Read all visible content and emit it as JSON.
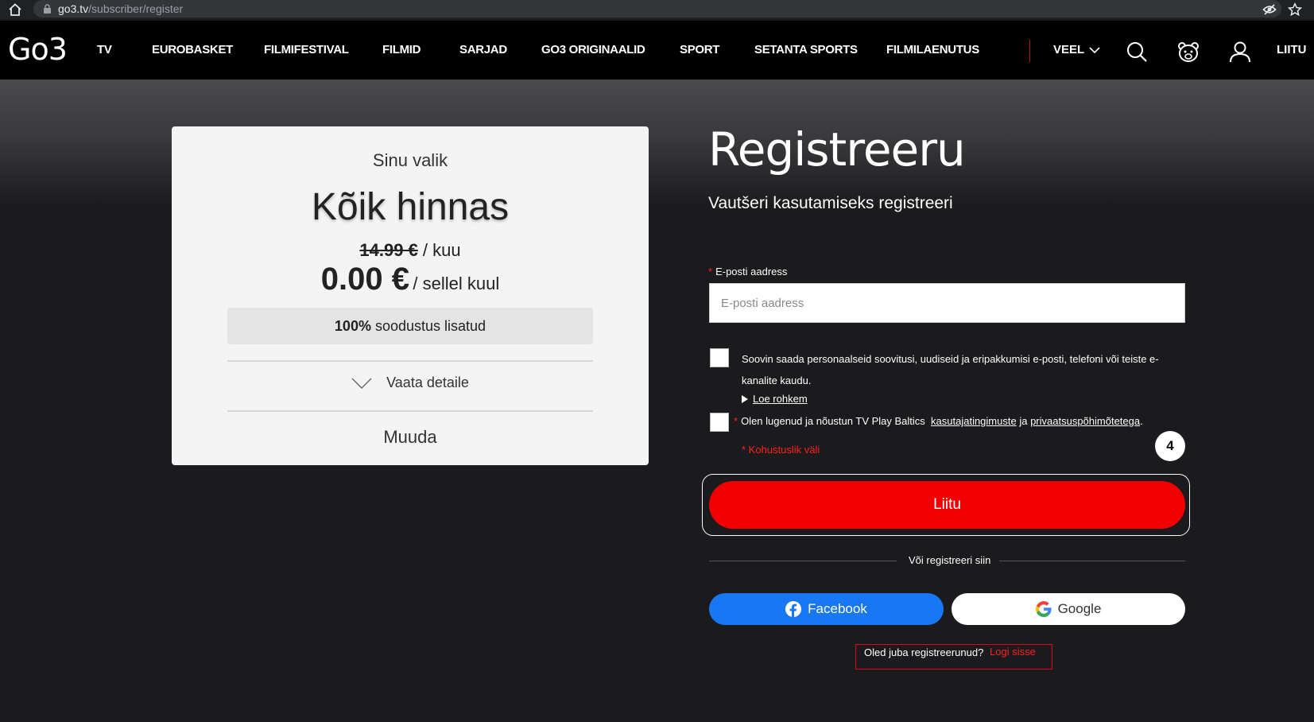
{
  "browser": {
    "url_host": "go3.tv",
    "url_path": "/subscriber/register"
  },
  "nav": {
    "logo": "Go3",
    "items": [
      "TV",
      "EUROBASKET",
      "FILMIFESTIVAL",
      "FILMID",
      "SARJAD",
      "GO3 ORIGINAALID",
      "SPORT",
      "SETANTA SPORTS",
      "FILMILAENUTUS"
    ],
    "more": "VEEL",
    "join": "LIITU",
    "accent_color": "#d4001a"
  },
  "plan": {
    "label": "Sinu valik",
    "name": "Kõik hinnas",
    "old_price": "14.99 €",
    "old_period": "/ kuu",
    "new_price": "0.00 €",
    "new_period": "/ sellel kuul",
    "discount_bold": "100%",
    "discount_text": "soodustus lisatud",
    "details": "Vaata detaile",
    "change": "Muuda"
  },
  "register": {
    "title": "Registreeru",
    "subtitle": "Vautšeri kasutamiseks registreeri",
    "email_label": "E-posti aadress",
    "email_placeholder": "E-posti aadress",
    "marketing_consent": "Soovin saada personaalseid soovitusi, uudiseid ja eripakkumisi e-posti, telefoni või teiste e-kanalite kaudu.",
    "read_more": "Loe rohkem",
    "terms_prefix": "Olen lugenud ja nõustun TV Play Baltics",
    "terms_link": "kasutajatingimuste",
    "terms_and": "ja",
    "privacy_link": "privaatsuspõhimõtetega",
    "terms_suffix": ".",
    "required_note": "* Kohustuslik väli",
    "badge": "4",
    "submit": "Liitu",
    "or_text": "Või registreeri siin",
    "facebook": "Facebook",
    "google": "Google",
    "already": "Oled juba registreerunud?",
    "login": "Logi sisse",
    "primary_color": "#f00000",
    "facebook_color": "#1877f2"
  }
}
